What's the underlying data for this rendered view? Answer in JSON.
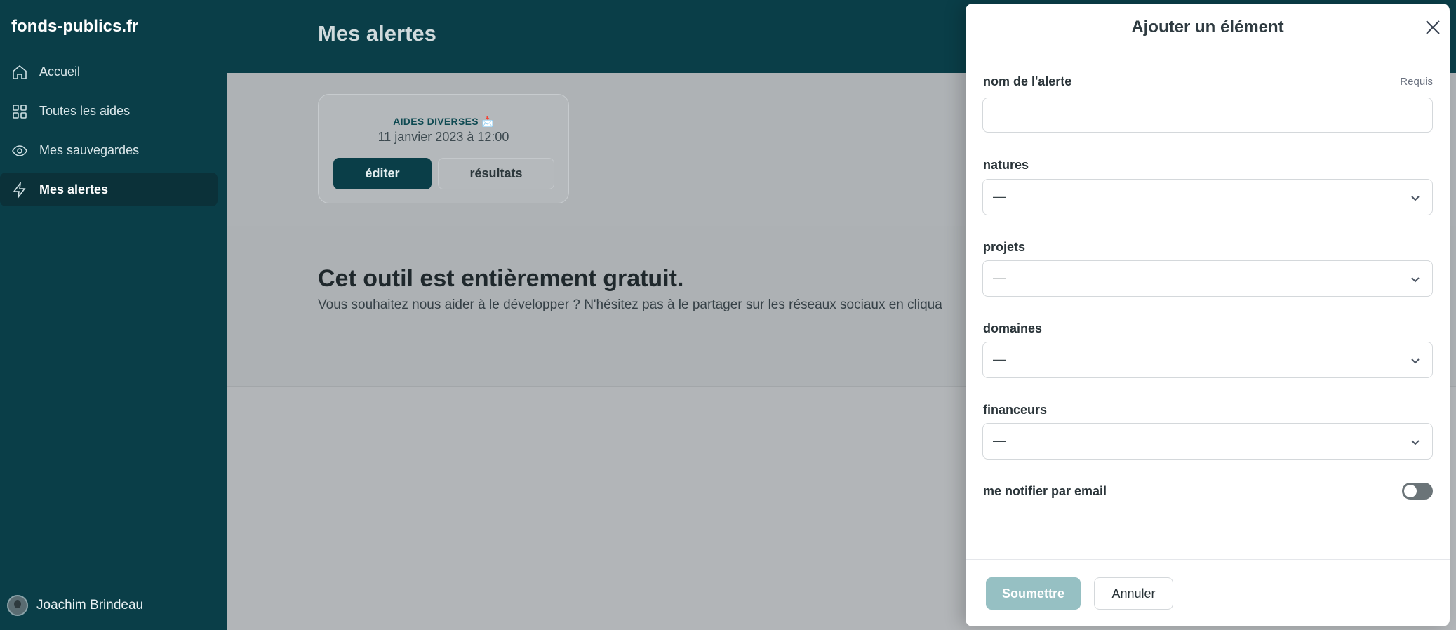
{
  "sidebar": {
    "brand": "fonds-publics.fr",
    "items": [
      {
        "label": "Accueil",
        "icon": "home-icon",
        "active": false
      },
      {
        "label": "Toutes les aides",
        "icon": "grid-icon",
        "active": false
      },
      {
        "label": "Mes sauvegardes",
        "icon": "eye-icon",
        "active": false
      },
      {
        "label": "Mes alertes",
        "icon": "lightning-icon",
        "active": true
      }
    ],
    "user": {
      "name": "Joachim Brindeau"
    }
  },
  "header": {
    "title": "Mes alertes"
  },
  "alert_card": {
    "kicker": "AIDES DIVERSES 📩",
    "date": "11 janvier 2023 à 12:00",
    "edit_label": "éditer",
    "results_label": "résultats"
  },
  "promo": {
    "title": "Cet outil est entièrement gratuit.",
    "text": "Vous souhaitez nous aider à le développer ? N'hésitez pas à le partager sur les réseaux sociaux en cliqua"
  },
  "modal": {
    "title": "Ajouter un élément",
    "name_label": "nom de l'alerte",
    "required_label": "Requis",
    "name_value": "",
    "selects": [
      {
        "label": "natures",
        "value": "—"
      },
      {
        "label": "projets",
        "value": "—"
      },
      {
        "label": "domaines",
        "value": "—"
      },
      {
        "label": "financeurs",
        "value": "—"
      }
    ],
    "notify_label": "me notifier par email",
    "notify_enabled": false,
    "submit_label": "Soumettre",
    "cancel_label": "Annuler"
  },
  "colors": {
    "sidebar_bg": "#0a3e48",
    "primary": "#0a3e48",
    "submit_disabled": "#96c0c3"
  }
}
